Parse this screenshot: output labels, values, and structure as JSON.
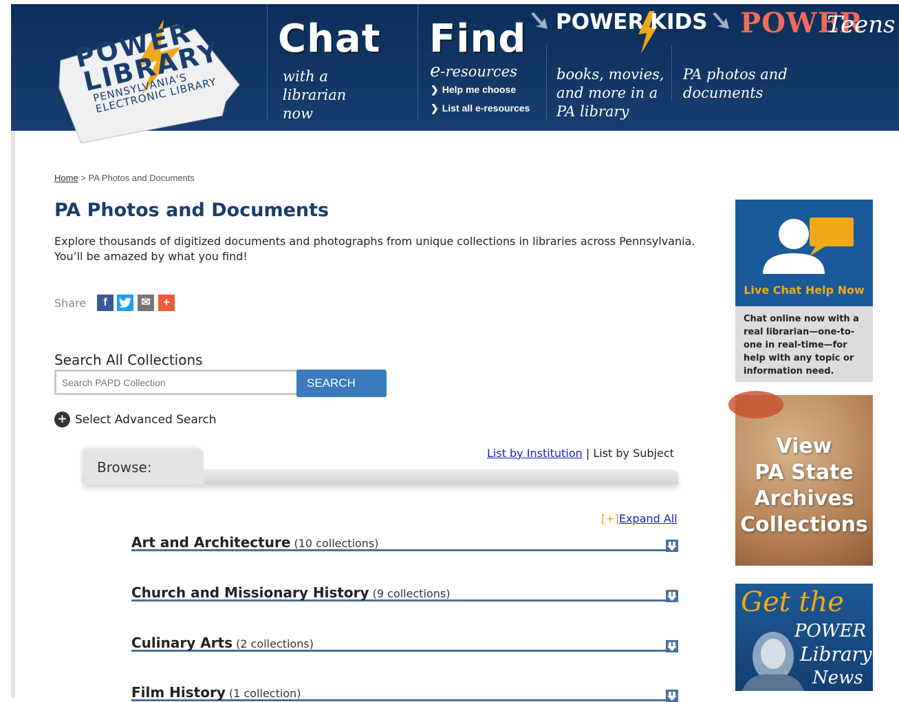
{
  "header": {
    "logo": {
      "text_line1": "POWER",
      "text_line2": "LIBRARY",
      "text_line3": "PENNSYLVANIA'S",
      "text_line4": "ELECTRONIC LIBRARY"
    },
    "chat": {
      "title": "Chat",
      "subtitle_1": "with a",
      "subtitle_2": "librarian",
      "subtitle_3": "now"
    },
    "find": {
      "title": "Find",
      "eres_e": "e",
      "eres_rest": "-resources",
      "link_help": "Help me choose",
      "link_list": "List all e-resources"
    },
    "books": {
      "line1": "books, movies,",
      "line2": "and more in a",
      "line3": "PA library"
    },
    "photos": {
      "line1": "PA photos and",
      "line2": "documents"
    },
    "power_kids": {
      "power": "POWER",
      "kids": "KIDS"
    },
    "power_teens": {
      "power": "POWER",
      "teens": "Teens"
    }
  },
  "breadcrumb": {
    "home": "Home",
    "separator": " > ",
    "current": "PA Photos and Documents"
  },
  "page_title": "PA Photos and Documents",
  "intro": "Explore thousands of digitized documents and photographs from unique collections in libraries across Pennsylvania. You’ll be amazed by what you find!",
  "share": {
    "label": "Share",
    "facebook": "f",
    "email": "✉",
    "more": "+"
  },
  "search": {
    "title": "Search All Collections",
    "placeholder": "Search PAPD Collection",
    "button": "SEARCH"
  },
  "advanced": {
    "label": "Select Advanced Search",
    "icon": "+"
  },
  "browse": {
    "label": "Browse:",
    "by_institution": "List by Institution",
    "separator": " | ",
    "by_subject": "List by Subject",
    "expand_open": "[+]",
    "expand_all": "Expand All",
    "categories": [
      {
        "name": "Art and Architecture",
        "count": "(10 collections)"
      },
      {
        "name": "Church and Missionary History",
        "count": "(9 collections)"
      },
      {
        "name": "Culinary Arts",
        "count": "(2 collections)"
      },
      {
        "name": "Film History",
        "count": "(1 collection)"
      }
    ]
  },
  "sidebar": {
    "chat_card": {
      "title": "Live Chat Help Now",
      "body": "Chat online now with a real librarian—one-to-one in real-time—for help with any topic or information need."
    },
    "archives_card": {
      "line1": "View",
      "line2": "PA State",
      "line3": "Archives",
      "line4": "Collections"
    },
    "news_card": {
      "line1": "Get the",
      "line2": "POWER",
      "line3": "Library",
      "line4": "News"
    }
  },
  "colors": {
    "header_bg": "#123665",
    "title_blue": "#1a3d6d",
    "button_blue": "#3a7abd",
    "link_blue": "#1a1acc",
    "accent_orange": "#f0a818",
    "teens_coral": "#ee6a5b"
  }
}
